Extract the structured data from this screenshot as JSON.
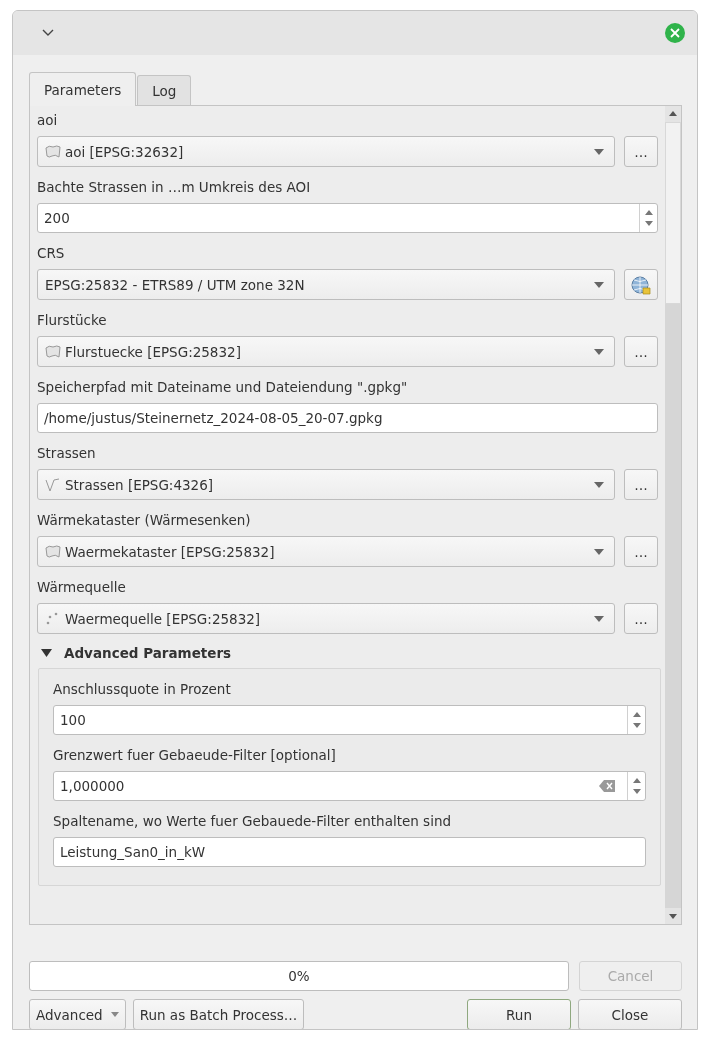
{
  "tabs": [
    {
      "label": "Parameters",
      "selected": true
    },
    {
      "label": "Log",
      "selected": false
    }
  ],
  "parameters": [
    {
      "kind": "polygon_layer",
      "label": "aoi",
      "value": "aoi [EPSG:32632]",
      "button": "…"
    },
    {
      "kind": "number",
      "label": "Bachte Strassen in …m Umkreis des AOI",
      "value": "200"
    },
    {
      "kind": "crs",
      "label": "CRS",
      "value": "EPSG:25832 - ETRS89 / UTM zone 32N"
    },
    {
      "kind": "polygon_layer",
      "label": "Flurstücke",
      "value": "Flurstuecke [EPSG:25832]",
      "button": "…"
    },
    {
      "kind": "text",
      "label": "Speicherpfad mit Dateiname und Dateiendung \".gpkg\"",
      "value": "/home/justus/Steinernetz_2024-08-05_20-07.gpkg"
    },
    {
      "kind": "line_layer",
      "label": "Strassen",
      "value": "Strassen [EPSG:4326]",
      "button": "…"
    },
    {
      "kind": "polygon_layer",
      "label": "Wärmekataster (Wärmesenken)",
      "value": "Waermekataster [EPSG:25832]",
      "button": "…"
    },
    {
      "kind": "point_layer",
      "label": "Wärmequelle",
      "value": "Waermequelle [EPSG:25832]",
      "button": "…"
    }
  ],
  "advanced": {
    "title": "Advanced Parameters",
    "expanded": true,
    "parameters": [
      {
        "kind": "number",
        "label": "Anschlussquote in Prozent",
        "value": "100"
      },
      {
        "kind": "number",
        "label": "Grenzwert fuer Gebaeude-Filter [optional]",
        "value": "1,000000",
        "clearable": true
      },
      {
        "kind": "text",
        "label": "Spaltename, wo Werte fuer Gebauede-Filter enthalten sind",
        "value": "Leistung_San0_in_kW"
      }
    ]
  },
  "progress": {
    "level": 0,
    "text": "0%"
  },
  "cancel": {
    "label": "Cancel",
    "disabled": true
  },
  "left_buttons": [
    {
      "label": "Advanced",
      "kind": "menu"
    },
    {
      "label": "Run as Batch Process…",
      "kind": "plain"
    }
  ],
  "right_buttons": [
    {
      "label": "Run",
      "default": true
    },
    {
      "label": "Close",
      "default": false
    }
  ]
}
